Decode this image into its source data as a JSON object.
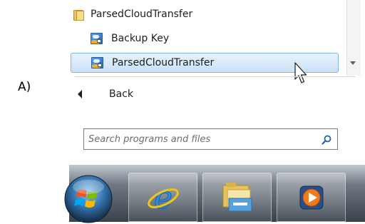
{
  "figure_label": "A)",
  "start_menu": {
    "folder": {
      "label": "ParsedCloudTransfer",
      "icon": "folder-icon"
    },
    "items": [
      {
        "label": "Backup Key",
        "icon": "app-icon",
        "highlighted": false
      },
      {
        "label": "ParsedCloudTransfer",
        "icon": "app-icon",
        "highlighted": true
      }
    ],
    "back_label": "Back",
    "search": {
      "placeholder": "Search programs and files",
      "icon": "magnifier-icon"
    }
  },
  "taskbar": {
    "buttons": [
      {
        "name": "start-orb",
        "icon": "windows-logo-icon"
      },
      {
        "name": "internet-explorer",
        "icon": "ie-icon"
      },
      {
        "name": "windows-explorer",
        "icon": "folder-icon"
      },
      {
        "name": "media-player",
        "icon": "play-icon"
      }
    ]
  },
  "colors": {
    "highlight": "#c9e1f7",
    "highlight_border": "#7eb4ea",
    "taskbar": "#39414b"
  }
}
